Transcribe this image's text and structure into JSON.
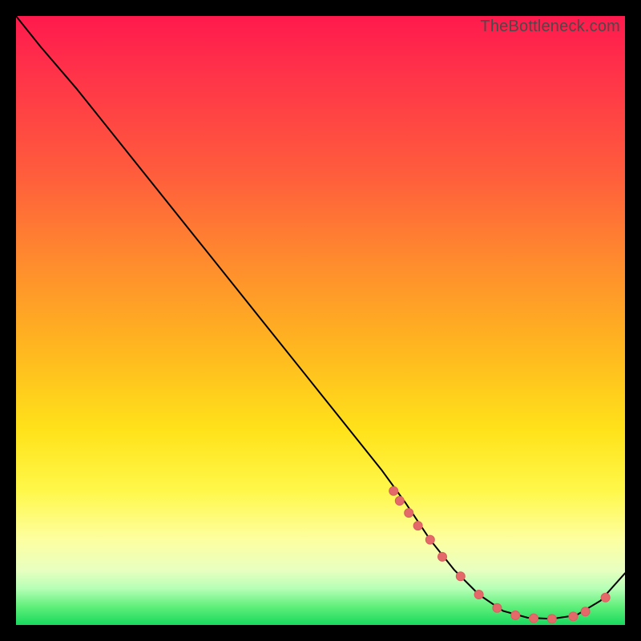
{
  "watermark": "TheBottleneck.com",
  "colors": {
    "curve_stroke": "#000000",
    "marker_fill": "#e46a6a",
    "marker_stroke": "#d85f5f"
  },
  "chart_data": {
    "type": "line",
    "title": "",
    "xlabel": "",
    "ylabel": "",
    "xlim": [
      0,
      100
    ],
    "ylim": [
      0,
      100
    ],
    "grid": false,
    "x": [
      0,
      4,
      10,
      20,
      30,
      40,
      50,
      60,
      64,
      68,
      72,
      76,
      80,
      84,
      88,
      92,
      96,
      100
    ],
    "y": [
      100,
      95,
      88,
      75.5,
      63,
      50.5,
      38,
      25.5,
      20,
      14,
      9,
      5,
      2.3,
      1.2,
      1.0,
      1.6,
      4.0,
      8.5
    ],
    "markers_x": [
      62,
      63,
      64.5,
      66,
      68,
      70,
      73,
      76,
      79,
      82,
      85,
      88,
      91.5,
      93.5,
      96.8
    ],
    "markers_y": [
      22,
      20.4,
      18.4,
      16.3,
      14,
      11.2,
      8,
      5,
      2.8,
      1.6,
      1.1,
      1.0,
      1.4,
      2.2,
      4.5
    ]
  }
}
